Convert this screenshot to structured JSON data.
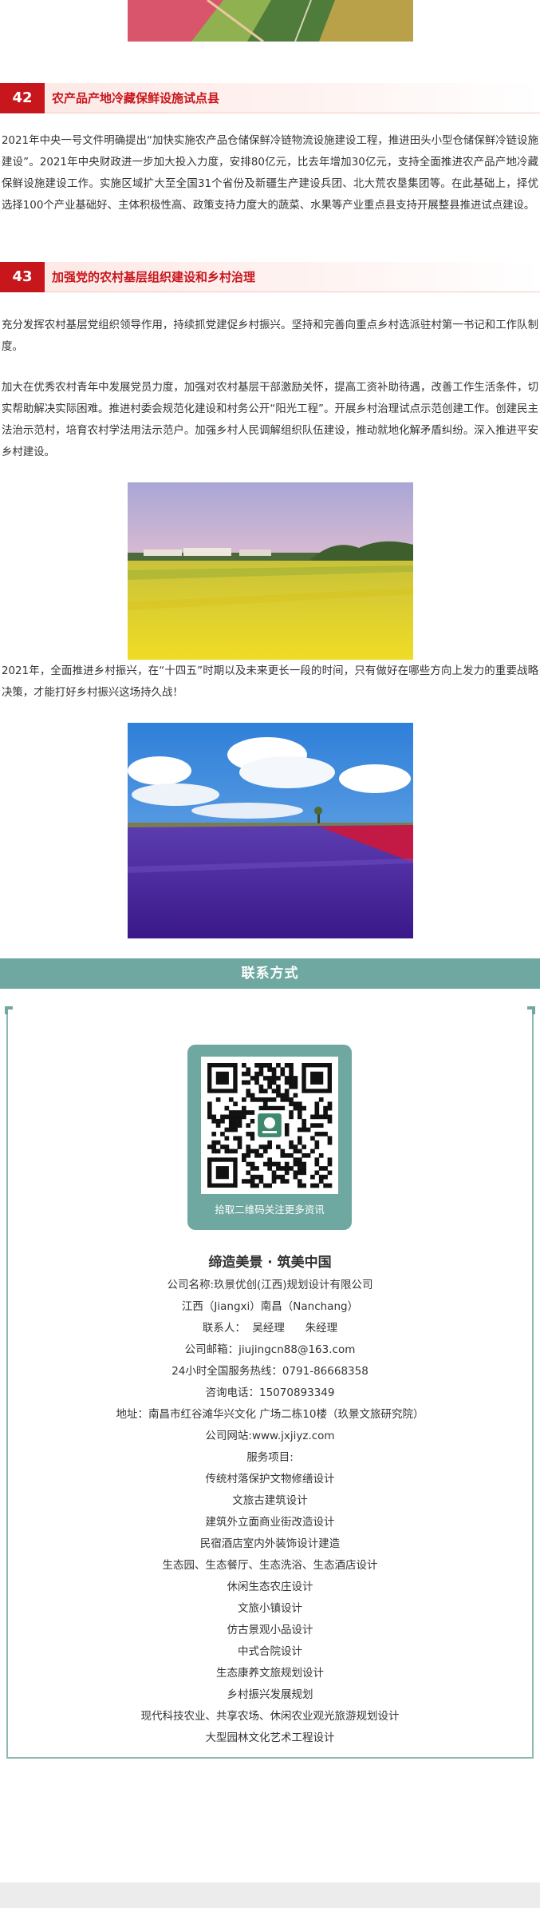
{
  "sections": [
    {
      "number": "42",
      "title": "农产品产地冷藏保鲜设施试点县",
      "paragraphs": [
        "2021年中央一号文件明确提出“加快实施农产品仓储保鲜冷链物流设施建设工程，推进田头小型仓储保鲜冷链设施建设”。2021年中央财政进一步加大投入力度，安排80亿元，比去年增加30亿元，支持全面推进农产品产地冷藏保鲜设施建设工作。实施区域扩大至全国31个省份及新疆生产建设兵团、北大荒农垦集团等。在此基础上，择优选择100个产业基础好、主体积极性高、政策支持力度大的蔬菜、水果等产业重点县支持开展整县推进试点建设。"
      ]
    },
    {
      "number": "43",
      "title": "加强党的农村基层组织建设和乡村治理",
      "paragraphs": [
        "充分发挥农村基层党组织领导作用，持续抓党建促乡村振兴。坚持和完善向重点乡村选派驻村第一书记和工作队制度。",
        "加大在优秀农村青年中发展党员力度，加强对农村基层干部激励关怀，提高工资补助待遇，改善工作生活条件，切实帮助解决实际困难。推进村委会规范化建设和村务公开“阳光工程”。开展乡村治理试点示范创建工作。创建民主法治示范村，培育农村学法用法示范户。加强乡村人民调解组织队伍建设，推动就地化解矛盾纠纷。深入推进平安乡村建设。"
      ]
    }
  ],
  "closing_paragraph": "2021年，全面推进乡村振兴，在“十四五”时期以及未来更长一段的时间，只有做好在哪些方向上发力的重要战略决策，才能打好乡村振兴这场持久战！",
  "contact": {
    "header": "联系方式",
    "qr_caption": "拾取二维码关注更多资讯",
    "slogan": "缔造美景 · 筑美中国",
    "company": "公司名称:玖景优创(江西)规划设计有限公司",
    "location": "江西（Jiangxi）南昌（Nanchang）",
    "contacts": "联系人：  吴经理      朱经理",
    "email": "公司邮箱：jiujingcn88@163.com",
    "hotline": "24小时全国服务热线：0791-86668358",
    "phone": "咨询电话：15070893349",
    "address": "地址：南昌市红谷滩华兴文化 广场二栋10楼（玖景文旅研究院）",
    "website": "公司网站:www.jxjiyz.com",
    "services_title": "服务项目:",
    "services": [
      "传统村落保护文物修缮设计",
      "文旅古建筑设计",
      "建筑外立面商业街改造设计",
      "民宿酒店室内外装饰设计建造",
      "生态园、生态餐厅、生态洗浴、生态酒店设计",
      "休闲生态农庄设计",
      "文旅小镇设计",
      "仿古景观小品设计",
      "中式合院设计",
      "生态康养文旅规划设计",
      "乡村振兴发展规划",
      "现代科技农业、共享农场、休闲农业观光旅游规划设计",
      "大型园林文化艺术工程设计"
    ]
  },
  "colors": {
    "accent_red": "#c8161d",
    "teal": "#6fa8a0",
    "rapeseed_yellow": "#e8d21e",
    "flower_purple": "#4a1f9e"
  },
  "icons": [
    "qr-code-icon",
    "company-logo-icon"
  ]
}
